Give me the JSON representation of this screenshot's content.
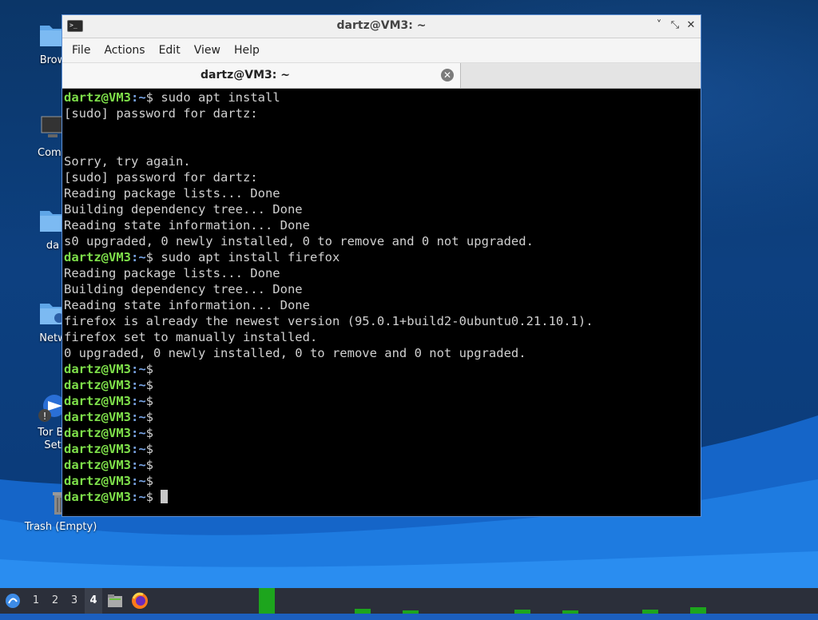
{
  "desktop": {
    "icons": [
      {
        "label": "Brow",
        "icon": "home-folder-icon"
      },
      {
        "label": "Comp",
        "icon": "computer-icon"
      },
      {
        "label": "da",
        "icon": "user-folder-icon"
      },
      {
        "label": "Netw",
        "icon": "network-folder-icon"
      },
      {
        "label": "Tor Br",
        "label2": "Set",
        "icon": "tor-browser-icon"
      },
      {
        "label": "Trash (Empty)",
        "icon": "trash-icon"
      }
    ]
  },
  "window": {
    "title": "dartz@VM3: ~",
    "controls": {
      "minimize": "˅",
      "maximize": "⤡",
      "close": "✕"
    },
    "menu": [
      "File",
      "Actions",
      "Edit",
      "View",
      "Help"
    ],
    "tab": {
      "title": "dartz@VM3: ~",
      "close": "✕"
    }
  },
  "terminal": {
    "prompt_user": "dartz@VM3",
    "prompt_path": ":~",
    "prompt_symbol": "$",
    "lines": [
      {
        "type": "prompt",
        "cmd": " sudo apt install"
      },
      {
        "type": "out",
        "text": "[sudo] password for dartz:"
      },
      {
        "type": "out",
        "text": ""
      },
      {
        "type": "out",
        "text": ""
      },
      {
        "type": "out",
        "text": "Sorry, try again."
      },
      {
        "type": "out",
        "text": "[sudo] password for dartz:"
      },
      {
        "type": "out",
        "text": "Reading package lists... Done"
      },
      {
        "type": "out",
        "text": "Building dependency tree... Done"
      },
      {
        "type": "out",
        "text": "Reading state information... Done"
      },
      {
        "type": "out",
        "text": "s0 upgraded, 0 newly installed, 0 to remove and 0 not upgraded."
      },
      {
        "type": "prompt",
        "cmd": " sudo apt install firefox"
      },
      {
        "type": "out",
        "text": "Reading package lists... Done"
      },
      {
        "type": "out",
        "text": "Building dependency tree... Done"
      },
      {
        "type": "out",
        "text": "Reading state information... Done"
      },
      {
        "type": "out",
        "text": "firefox is already the newest version (95.0.1+build2-0ubuntu0.21.10.1)."
      },
      {
        "type": "out",
        "text": "firefox set to manually installed."
      },
      {
        "type": "out",
        "text": "0 upgraded, 0 newly installed, 0 to remove and 0 not upgraded."
      },
      {
        "type": "prompt",
        "cmd": ""
      },
      {
        "type": "prompt",
        "cmd": ""
      },
      {
        "type": "prompt",
        "cmd": ""
      },
      {
        "type": "prompt",
        "cmd": ""
      },
      {
        "type": "prompt",
        "cmd": ""
      },
      {
        "type": "prompt",
        "cmd": ""
      },
      {
        "type": "prompt",
        "cmd": ""
      },
      {
        "type": "prompt",
        "cmd": ""
      },
      {
        "type": "prompt",
        "cmd": " ",
        "cursor": true
      }
    ]
  },
  "taskbar": {
    "start_icon": "lubuntu-start-icon",
    "workspaces": [
      "1",
      "2",
      "3",
      "4"
    ],
    "active_workspace": "4",
    "launchers": [
      "file-manager-icon",
      "firefox-icon"
    ],
    "cpu_monitor_color": "#1da51d"
  }
}
